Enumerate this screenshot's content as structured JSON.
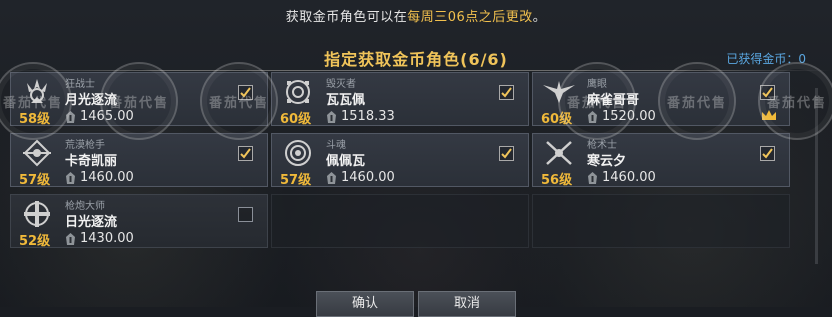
{
  "notice": {
    "prefix": "获取金币角色可以在",
    "highlight": "每周三06点之后更改",
    "suffix": "。"
  },
  "dialog": {
    "title": "指定获取金币角色(6/6)",
    "gold_obtained_label": "已获得金币：",
    "gold_obtained_value": "0"
  },
  "watermark_text": "番茄代售",
  "characters": [
    {
      "class": "狂战士",
      "name": "月光逐流",
      "level": "58级",
      "gold": "1465.00",
      "checked": true,
      "icon": "berserker-emblem-icon"
    },
    {
      "class": "毁灭者",
      "name": "瓦瓦佩",
      "level": "60级",
      "gold": "1518.33",
      "checked": true,
      "icon": "destroyer-emblem-icon"
    },
    {
      "class": "鹰眼",
      "name": "麻雀哥哥",
      "level": "60级",
      "gold": "1520.00",
      "checked": true,
      "icon": "hawkeye-emblem-icon",
      "crown": true
    },
    {
      "class": "荒漠枪手",
      "name": "卡奇凯丽",
      "level": "57级",
      "gold": "1460.00",
      "checked": true,
      "icon": "gunslinger-emblem-icon"
    },
    {
      "class": "斗魂",
      "name": "佩佩瓦",
      "level": "57级",
      "gold": "1460.00",
      "checked": true,
      "icon": "soul-fist-emblem-icon"
    },
    {
      "class": "枪术士",
      "name": "寒云夕",
      "level": "56级",
      "gold": "1460.00",
      "checked": true,
      "icon": "lancer-emblem-icon"
    },
    {
      "class": "枪炮大师",
      "name": "日光逐流",
      "level": "52级",
      "gold": "1430.00",
      "checked": false,
      "icon": "artillerist-emblem-icon"
    }
  ],
  "buttons": {
    "confirm": "确认",
    "cancel": "取消"
  },
  "colors": {
    "accent_gold": "#f0c45a",
    "level_gold": "#f0b93a",
    "info_blue": "#5aa6e0"
  }
}
